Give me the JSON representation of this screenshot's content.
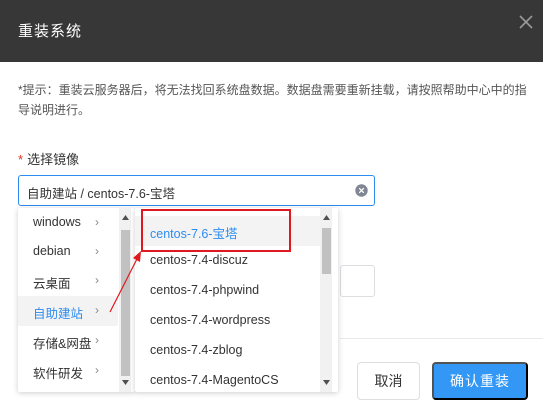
{
  "dialog": {
    "title": "重装系统",
    "notice": "*提示：重装云服务器后，将无法找回系统盘数据。数据盘需要重新挂载，请按照帮助中心中的指导说明进行。",
    "image_label": "选择镜像",
    "required_mark": "*",
    "selected_value": "自助建站 / centos-7.6-宝塔",
    "cancel_label": "取消",
    "confirm_label": "确认重装"
  },
  "cascader": {
    "categories": [
      {
        "label": "windows",
        "chevron": "›"
      },
      {
        "label": "debian",
        "chevron": "›"
      },
      {
        "label": "云桌面",
        "chevron": "›"
      },
      {
        "label": "自助建站",
        "chevron": "›"
      },
      {
        "label": "存储&网盘",
        "chevron": "›"
      },
      {
        "label": "软件研发",
        "chevron": "›"
      }
    ],
    "active_category": "自助建站",
    "images": [
      "centos-7.6-宝塔",
      "centos-7.4-discuz",
      "centos-7.4-phpwind",
      "centos-7.4-wordpress",
      "centos-7.4-zblog",
      "centos-7.4-MagentoCS"
    ],
    "active_image": "centos-7.6-宝塔"
  },
  "icons": {
    "close": "close-icon",
    "clear": "clear-circle-icon",
    "chevron": "chevron-right-icon"
  },
  "colors": {
    "header_bg": "#373737",
    "accent": "#2d8cf0",
    "confirm_bg": "#3397f5",
    "annotation": "#e0191e"
  }
}
